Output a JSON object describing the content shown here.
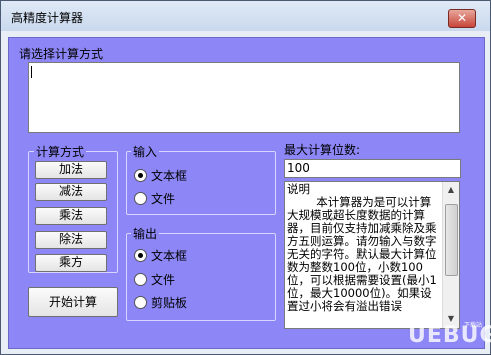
{
  "window": {
    "title": "高精度计算器",
    "close_label": "✕"
  },
  "input_section": {
    "label": "请选择计算方式",
    "value": ""
  },
  "methods": {
    "title": "计算方式",
    "buttons": [
      "加法",
      "减法",
      "乘法",
      "除法",
      "乘方"
    ]
  },
  "input_group": {
    "title": "输入",
    "options": [
      "文本框",
      "文件"
    ],
    "selected": "文本框"
  },
  "output_group": {
    "title": "输出",
    "options": [
      "文本框",
      "文件",
      "剪贴板"
    ],
    "selected": "文本框"
  },
  "start_button": "开始计算",
  "max_digits": {
    "label": "最大计算位数:",
    "value": "100"
  },
  "notes": {
    "text": "说明\n        本计算器为是可以计算大规模或超长度数据的计算器，目前仅支持加减乘除及乘方五则运算。请勿输入与数字无关的字符。默认最大计算位数为整数100位，小数100位，可以根据需要设置(最小1位，最大10000位)。如果设置过小将会有溢出错误"
  },
  "watermark": {
    "text": "UEBUG",
    "sub": "下载站"
  },
  "colors": {
    "client_bg": "#8c86f6",
    "title_bg": "#c9d9ee",
    "close_bg": "#c7453a"
  }
}
